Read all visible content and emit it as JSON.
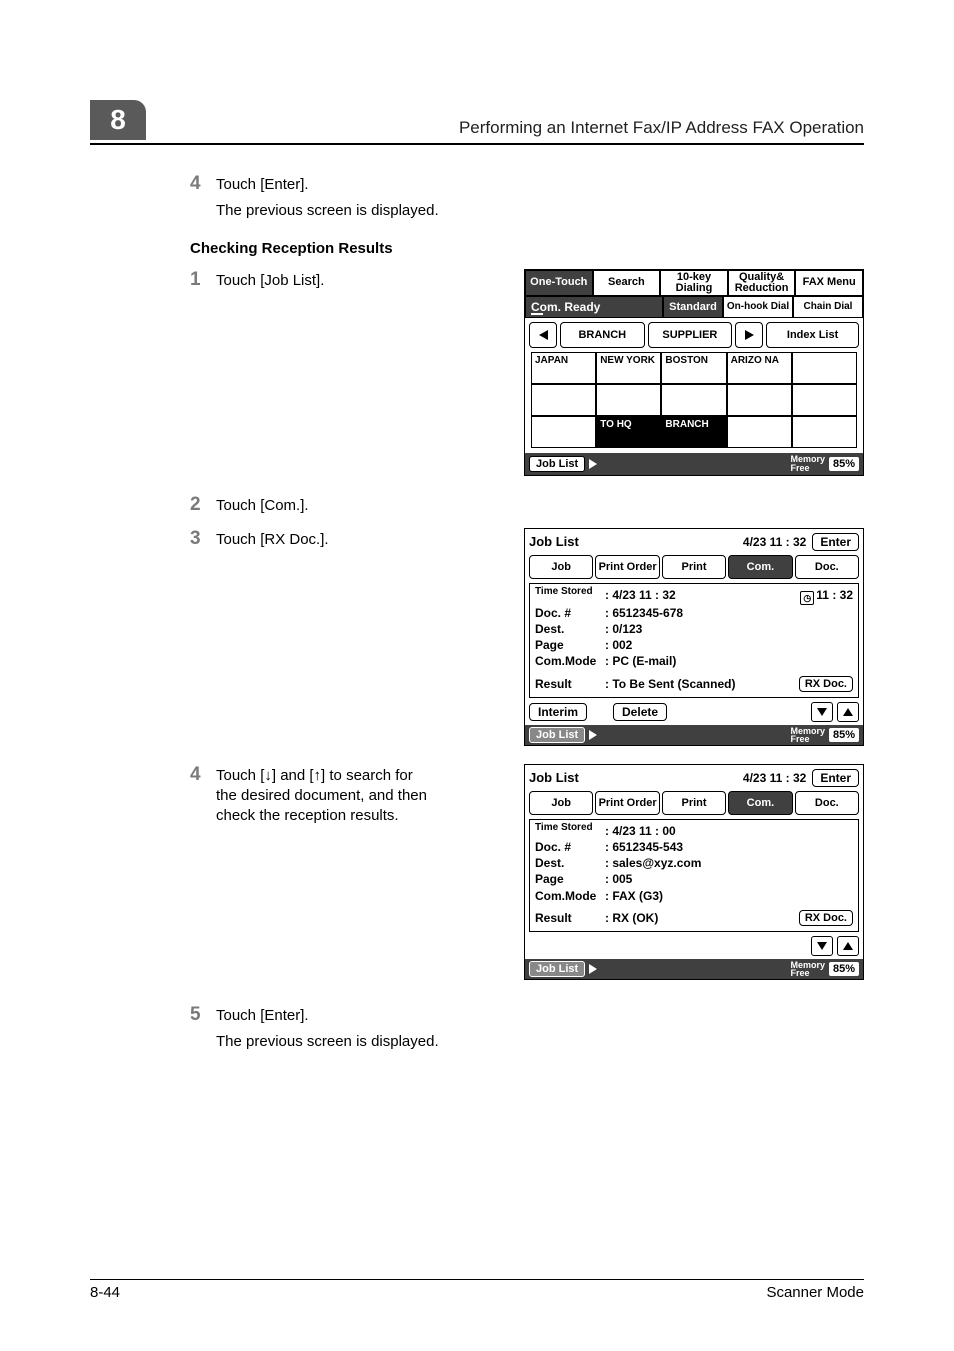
{
  "header": {
    "chapter_number": "8",
    "chapter_title": "Performing an Internet Fax/IP Address FAX Operation"
  },
  "step4a": {
    "num": "4",
    "text": "Touch [Enter].",
    "sub": "The previous screen is displayed."
  },
  "section_heading": "Checking Reception Results",
  "step1": {
    "num": "1",
    "text": "Touch [Job List]."
  },
  "panel1": {
    "tabs": [
      "One-Touch",
      "Search",
      "10-key Dialing",
      "Quality& Reduction",
      "FAX Menu"
    ],
    "ready": "Com. Ready",
    "standard": "Standard",
    "onhook": "On-hook Dial",
    "chain": "Chain Dial",
    "row3": {
      "branch": "BRANCH",
      "supplier": "SUPPLIER",
      "index": "Index List"
    },
    "grid": {
      "r1": [
        "JAPAN",
        "NEW YORK",
        "BOSTON",
        "ARIZO NA",
        ""
      ],
      "r2": [
        "",
        "",
        "",
        "",
        ""
      ],
      "r3": [
        "",
        "TO HQ",
        "BRANCH",
        "",
        ""
      ]
    },
    "joblist": "Job List",
    "mem_label1": "Memory",
    "mem_label2": "Free",
    "pct": "85%"
  },
  "step2": {
    "num": "2",
    "text": "Touch [Com.]."
  },
  "step3": {
    "num": "3",
    "text": "Touch [RX Doc.]."
  },
  "panel2": {
    "title": "Job List",
    "time": "4/23 11 : 32",
    "enter": "Enter",
    "tabs": [
      "Job",
      "Print Order",
      "Print",
      "Com.",
      "Doc."
    ],
    "active_tab_index": 3,
    "lines": {
      "stored_label": "Time Stored",
      "stored": ": 4/23  11 : 32",
      "doc_label": "Doc. #",
      "doc": ": 6512345-678",
      "dest_label": "Dest.",
      "dest": ":   0/123",
      "page_label": "Page",
      "page": ": 002",
      "mode_label": "Com.Mode",
      "mode": ": PC (E-mail)",
      "result_label": "Result",
      "result": ": To Be Sent (Scanned)",
      "rec_time": "11 : 32"
    },
    "rxdoc": "RX Doc.",
    "interim": "Interim",
    "delete": "Delete",
    "joblist": "Job List",
    "mem_label1": "Memory",
    "mem_label2": "Free",
    "pct": "85%"
  },
  "step4b": {
    "num": "4",
    "text": "Touch [↓] and [↑] to search for the desired document, and then check the reception results."
  },
  "panel3": {
    "title": "Job List",
    "time": "4/23 11 : 32",
    "enter": "Enter",
    "tabs": [
      "Job",
      "Print Order",
      "Print",
      "Com.",
      "Doc."
    ],
    "active_tab_index": 3,
    "lines": {
      "stored_label": "Time Stored",
      "stored": ": 4/23  11 : 00",
      "doc_label": "Doc. #",
      "doc": ": 6512345-543",
      "dest_label": "Dest.",
      "dest": ": sales@xyz.com",
      "page_label": "Page",
      "page": ": 005",
      "mode_label": "Com.Mode",
      "mode": ": FAX (G3)",
      "result_label": "Result",
      "result": ": RX (OK)"
    },
    "rxdoc": "RX Doc.",
    "joblist": "Job List",
    "mem_label1": "Memory",
    "mem_label2": "Free",
    "pct": "85%"
  },
  "step5": {
    "num": "5",
    "text": "Touch [Enter].",
    "sub": "The previous screen is displayed."
  },
  "footer": {
    "left": "8-44",
    "right": "Scanner Mode"
  }
}
